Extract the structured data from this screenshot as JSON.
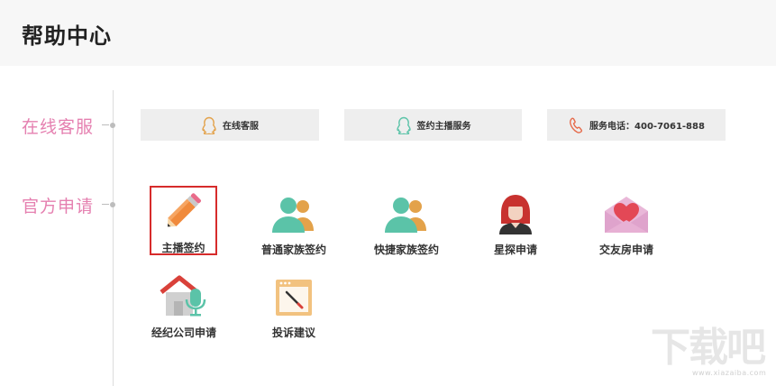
{
  "header": {
    "title": "帮助中心"
  },
  "sections": {
    "online": {
      "label": "在线客服"
    },
    "apply": {
      "label": "官方申请"
    }
  },
  "service_buttons": [
    {
      "label": "在线客服",
      "icon": "qq-penguin-icon",
      "color": "#e3a24a"
    },
    {
      "label": "签约主播服务",
      "icon": "qq-penguin-icon",
      "color": "#5bc3a8"
    },
    {
      "label": "服务电话：400-7061-888",
      "icon": "phone-icon",
      "color": "#e66a4a"
    }
  ],
  "apply_items": [
    {
      "label": "主播签约",
      "icon": "pencil-icon",
      "selected": true
    },
    {
      "label": "普通家族签约",
      "icon": "users-icon"
    },
    {
      "label": "快捷家族签约",
      "icon": "users-icon"
    },
    {
      "label": "星探申请",
      "icon": "woman-avatar-icon"
    },
    {
      "label": "交友房申请",
      "icon": "heart-envelope-icon"
    },
    {
      "label": "经纪公司申请",
      "icon": "house-microphone-icon"
    },
    {
      "label": "投诉建议",
      "icon": "complaint-window-icon"
    }
  ],
  "watermark": {
    "text": "下载吧",
    "url": "www.xiazaiba.com"
  }
}
